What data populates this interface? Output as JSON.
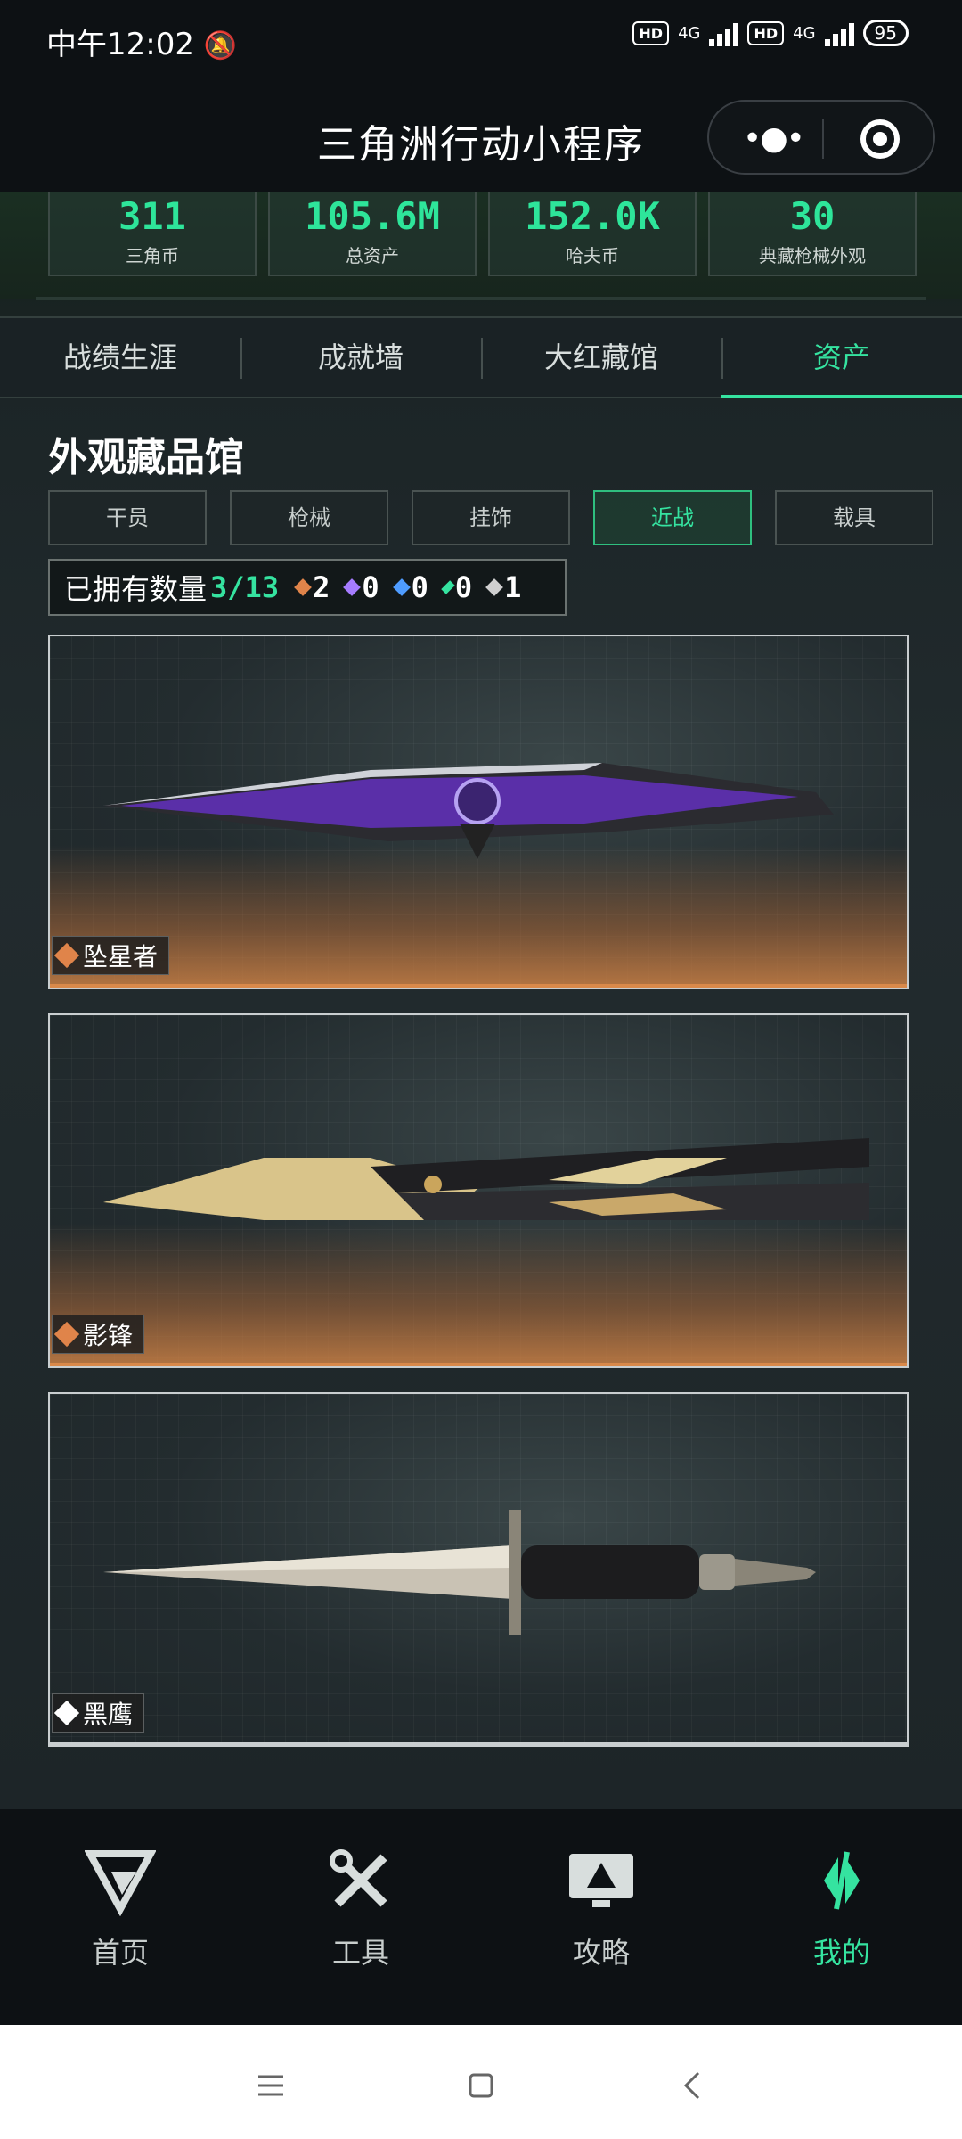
{
  "status": {
    "time": "中午12:02",
    "battery": "95",
    "net1": "4G",
    "net2": "4G",
    "hd": "HD"
  },
  "nav": {
    "title": "三角洲行动小程序"
  },
  "stats": [
    {
      "value": "311",
      "label": "三角币"
    },
    {
      "value": "105.6M",
      "label": "总资产"
    },
    {
      "value": "152.0K",
      "label": "哈夫币"
    },
    {
      "value": "30",
      "label": "典藏枪械外观"
    }
  ],
  "tabs": [
    {
      "label": "战绩生涯"
    },
    {
      "label": "成就墙"
    },
    {
      "label": "大红藏馆"
    },
    {
      "label": "资产",
      "active": true
    }
  ],
  "section_title": "外观藏品馆",
  "filters": [
    {
      "label": "干员"
    },
    {
      "label": "枪械"
    },
    {
      "label": "挂饰"
    },
    {
      "label": "近战",
      "active": true
    },
    {
      "label": "载具"
    }
  ],
  "owned": {
    "label": "已拥有数量",
    "count": "3/13",
    "rarity": [
      {
        "value": "2",
        "color": "#e0844a"
      },
      {
        "value": "0",
        "color": "#a67cff"
      },
      {
        "value": "0",
        "color": "#4f9cff"
      },
      {
        "value": "0",
        "color": "#35e3a0"
      },
      {
        "value": "1",
        "color": "#cfcfcf"
      }
    ]
  },
  "items": [
    {
      "name": "坠星者",
      "rarity_color": "#e0844a",
      "icon": "purple-dagger"
    },
    {
      "name": "影锋",
      "rarity_color": "#e0844a",
      "icon": "gold-butterfly-knife"
    },
    {
      "name": "黑鹰",
      "rarity_color": "#ffffff",
      "icon": "combat-knife"
    }
  ],
  "tabbar": [
    {
      "label": "首页",
      "icon": "home-logo-icon"
    },
    {
      "label": "工具",
      "icon": "tools-icon"
    },
    {
      "label": "攻略",
      "icon": "guide-monitor-icon"
    },
    {
      "label": "我的",
      "icon": "profile-logo-icon",
      "active": true
    }
  ],
  "colors": {
    "accent": "#35e3a0",
    "gold_rarity": "#e0844a",
    "background": "#222b2e"
  }
}
